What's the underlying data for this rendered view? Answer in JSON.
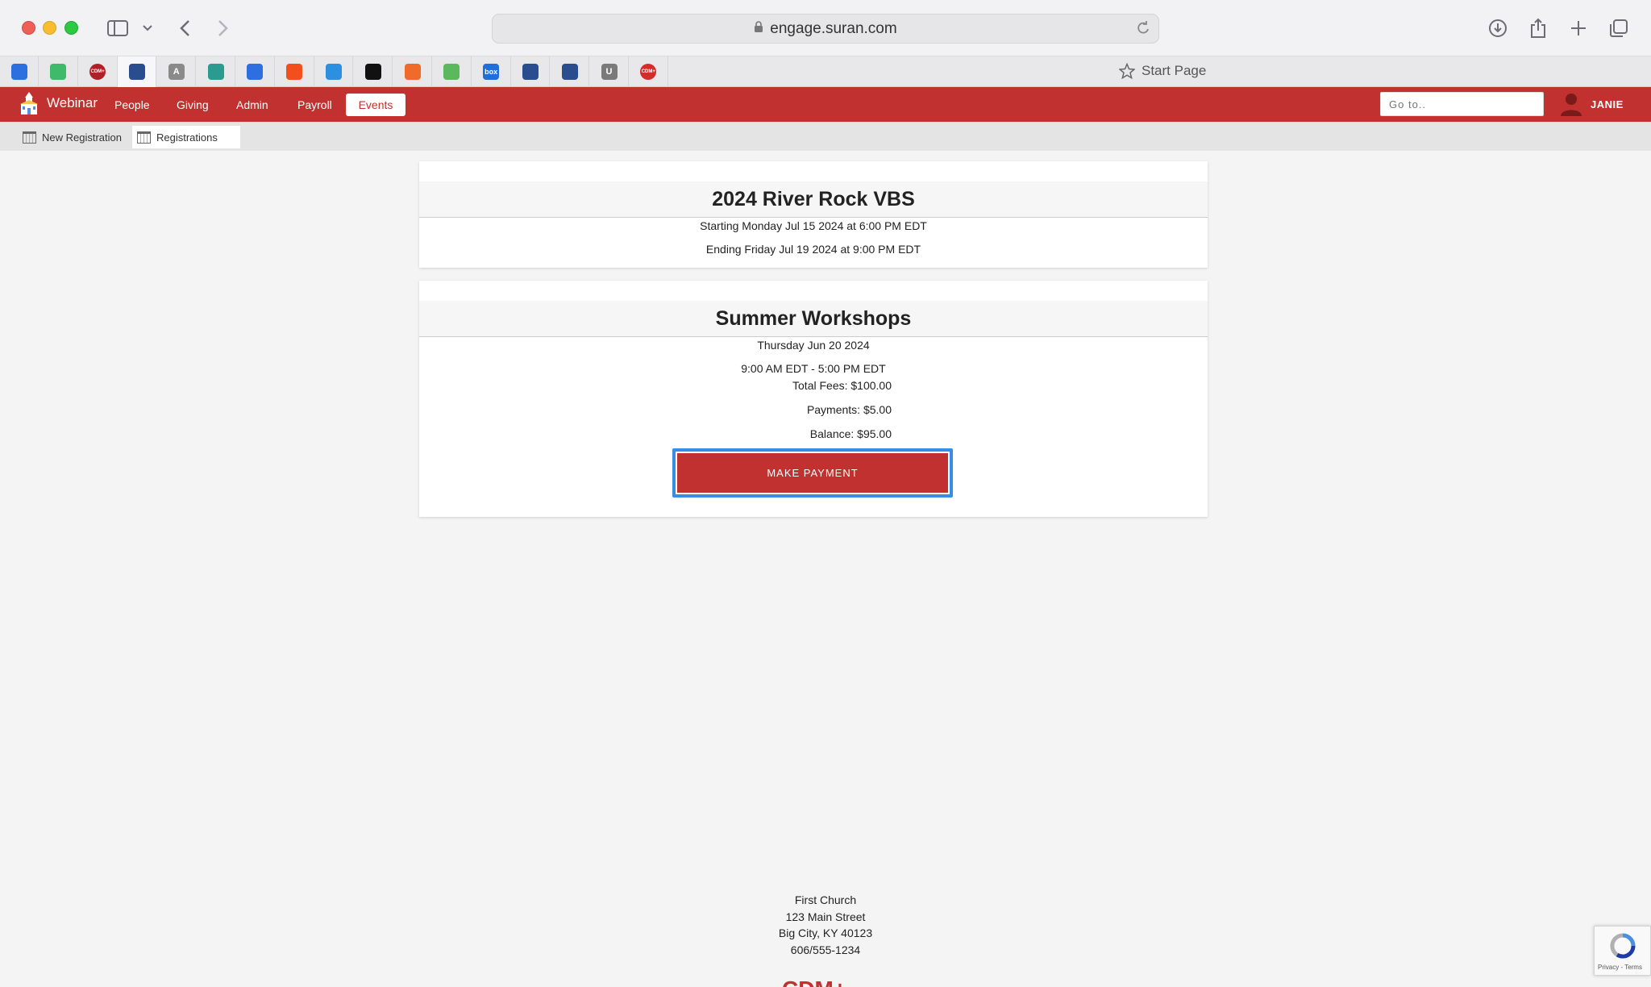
{
  "browser": {
    "url": "engage.suran.com",
    "start_page_label": "Start Page",
    "tabs": [
      {
        "icon": "jira-icon",
        "color": "#2d6fe0"
      },
      {
        "icon": "sheets-icon",
        "color": "#3fb96a"
      },
      {
        "icon": "cdm-icon",
        "color": "#b21f27",
        "text": "CDM+"
      },
      {
        "icon": "people-icon",
        "color": "#2a4d8f",
        "active": true
      },
      {
        "icon": "a-letter-icon",
        "color": "#8a8a8a",
        "text": "A"
      },
      {
        "icon": "cloud-icon",
        "color": "#2b9a8f"
      },
      {
        "icon": "jira-icon",
        "color": "#2d6fe0"
      },
      {
        "icon": "figma-icon",
        "color": "#f24e1e"
      },
      {
        "icon": "atlassian-icon",
        "color": "#2d8fe0"
      },
      {
        "icon": "spotify-icon",
        "color": "#111111"
      },
      {
        "icon": "clock-icon",
        "color": "#f06a2a"
      },
      {
        "icon": "stripes-icon",
        "color": "#5cb85c"
      },
      {
        "icon": "box-icon",
        "color": "#1e6fd9",
        "text": "box"
      },
      {
        "icon": "people-icon",
        "color": "#2a4d8f"
      },
      {
        "icon": "people-icon",
        "color": "#2a4d8f"
      },
      {
        "icon": "u-letter-icon",
        "color": "#7a7a7a",
        "text": "U"
      },
      {
        "icon": "cdm-icon",
        "color": "#d52b2b",
        "text": "CDM+"
      }
    ]
  },
  "appnav": {
    "brand": "Webinar",
    "items": [
      "People",
      "Giving",
      "Admin",
      "Payroll",
      "Events"
    ],
    "active": "Events",
    "goto_placeholder": "Go to..",
    "user": "JANIE",
    "accent": "#c0312f"
  },
  "subnav": {
    "items": [
      "New Registration",
      "Registrations"
    ],
    "active": "Registrations"
  },
  "events": [
    {
      "title": "2024 River Rock VBS",
      "start": "Starting Monday Jul 15 2024 at 6:00 PM EDT",
      "end": "Ending Friday Jul 19 2024 at 9:00 PM EDT"
    },
    {
      "title": "Summer Workshops",
      "date": "Thursday Jun 20 2024",
      "time": "9:00 AM EDT - 5:00 PM EDT",
      "total_fees": "Total Fees: $100.00",
      "payments": "Payments: $5.00",
      "balance": "Balance: $95.00",
      "button": "MAKE PAYMENT"
    }
  ],
  "footer": {
    "name": "First Church",
    "street": "123 Main Street",
    "city": "Big City, KY 40123",
    "phone": "606/555-1234",
    "logo_text": "CDM+"
  },
  "recaptcha": {
    "text": "Privacy - Terms"
  }
}
